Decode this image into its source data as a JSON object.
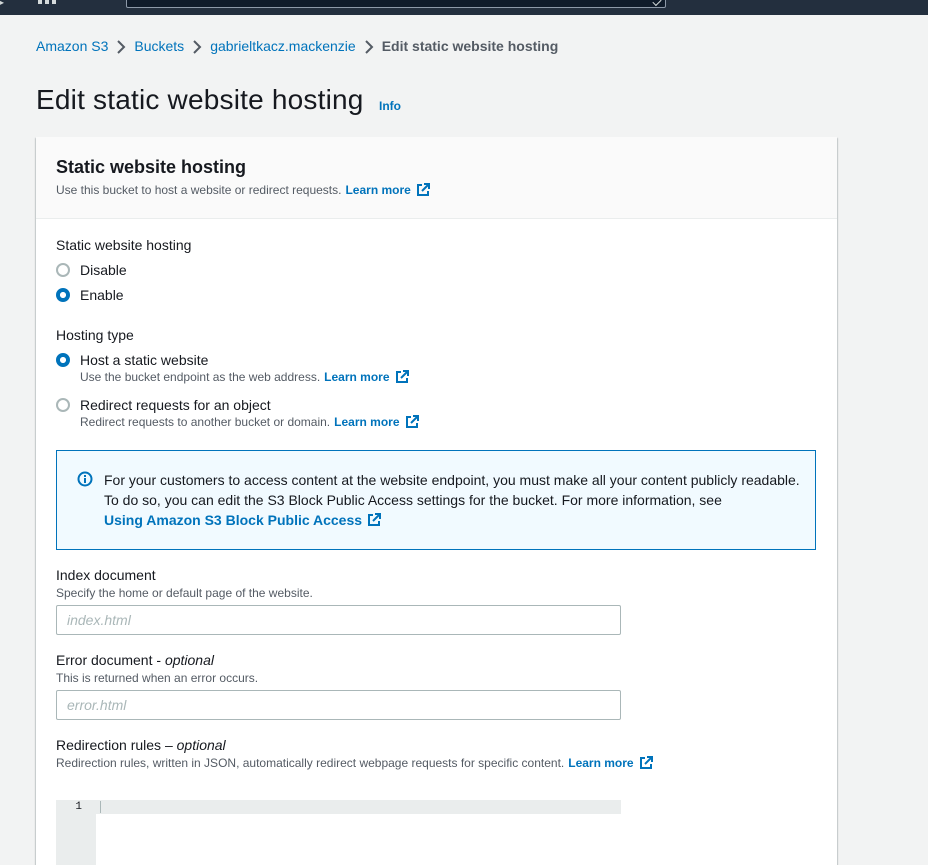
{
  "breadcrumb": {
    "items": [
      "Amazon S3",
      "Buckets",
      "gabrieltkacz.mackenzie"
    ],
    "current": "Edit static website hosting"
  },
  "page": {
    "title": "Edit static website hosting",
    "info_label": "Info"
  },
  "panel": {
    "title": "Static website hosting",
    "description": "Use this bucket to host a website or redirect requests.",
    "learn_more": "Learn more"
  },
  "hosting_toggle": {
    "label": "Static website hosting",
    "options": [
      {
        "label": "Disable",
        "checked": false
      },
      {
        "label": "Enable",
        "checked": true
      }
    ]
  },
  "hosting_type": {
    "label": "Hosting type",
    "options": [
      {
        "label": "Host a static website",
        "description": "Use the bucket endpoint as the web address.",
        "learn_more": "Learn more",
        "checked": true
      },
      {
        "label": "Redirect requests for an object",
        "description": "Redirect requests to another bucket or domain.",
        "learn_more": "Learn more",
        "checked": false
      }
    ]
  },
  "alert": {
    "text": "For your customers to access content at the website endpoint, you must make all your content publicly readable. To do so, you can edit the S3 Block Public Access settings for the bucket. For more information, see",
    "link": "Using Amazon S3 Block Public Access"
  },
  "index_document": {
    "label": "Index document",
    "description": "Specify the home or default page of the website.",
    "placeholder": "index.html",
    "value": ""
  },
  "error_document": {
    "label": "Error document - ",
    "optional": "optional",
    "description": "This is returned when an error occurs.",
    "placeholder": "error.html",
    "value": ""
  },
  "redirection_rules": {
    "label": "Redirection rules – ",
    "optional": "optional",
    "description": "Redirection rules, written in JSON, automatically redirect webpage requests for specific content.",
    "learn_more": "Learn more",
    "line_number": "1"
  },
  "colors": {
    "link": "#0073bb",
    "topbar": "#232f3e",
    "background": "#f2f3f3",
    "alert_bg": "#f1faff"
  }
}
